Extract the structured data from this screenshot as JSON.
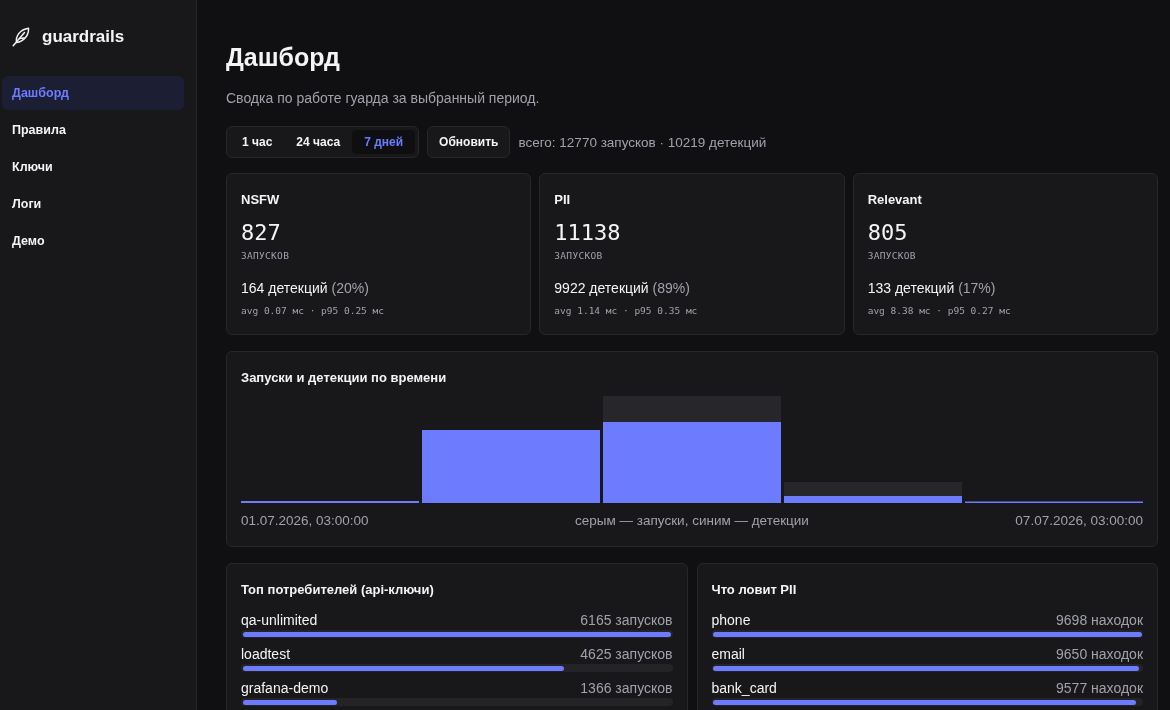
{
  "sidebar": {
    "logo": "guardrails",
    "items": [
      {
        "label": "Дашборд",
        "selected": true
      },
      {
        "label": "Правила",
        "selected": false
      },
      {
        "label": "Ключи",
        "selected": false
      },
      {
        "label": "Логи",
        "selected": false
      },
      {
        "label": "Демо",
        "selected": false
      }
    ]
  },
  "header": {
    "title": "Дашборд",
    "subtitle": "Сводка по работе гуарда за выбранный период."
  },
  "toolbar": {
    "periods": [
      {
        "label": "1 час",
        "selected": false
      },
      {
        "label": "24 часа",
        "selected": false
      },
      {
        "label": "7 дней",
        "selected": true
      }
    ],
    "refresh_button": "Обновить",
    "totals": "всего: 12770 запусков · 10219 детекций"
  },
  "guards": [
    {
      "name": "NSFW",
      "runs": "827",
      "runs_label": "ЗАПУСКОВ",
      "detections": "164 детекций",
      "share": "(20%)",
      "latency": "avg 0.07 мс · p95 0.25 мс"
    },
    {
      "name": "PII",
      "runs": "11138",
      "runs_label": "ЗАПУСКОВ",
      "detections": "9922 детекций",
      "share": "(89%)",
      "latency": "avg 1.14 мс · p95 0.35 мс"
    },
    {
      "name": "Relevant",
      "runs": "805",
      "runs_label": "ЗАПУСКОВ",
      "detections": "133 детекций",
      "share": "(17%)",
      "latency": "avg 8.38 мс · p95 0.27 мс"
    }
  ],
  "timeline": {
    "title": "Запуски и детекции по времени",
    "start_label": "01.07.2026, 03:00:00",
    "legend": "серым — запуски, синим — детекции",
    "end_label": "07.07.2026, 03:00:00"
  },
  "top_consumers": {
    "title": "Топ потребителей (api-ключи)",
    "rows": [
      {
        "name": "qa-unlimited",
        "count": "6165 запусков",
        "level": 1.0
      },
      {
        "name": "loadtest",
        "count": "4625 запусков",
        "level": 0.75
      },
      {
        "name": "grafana-demo",
        "count": "1366 запусков",
        "level": 0.22
      }
    ]
  },
  "pii_findings": {
    "title": "Что ловит PII",
    "rows": [
      {
        "name": "phone",
        "count": "9698 находок",
        "level": 1.0
      },
      {
        "name": "email",
        "count": "9650 находок",
        "level": 0.995
      },
      {
        "name": "bank_card",
        "count": "9577 находок",
        "level": 0.987
      }
    ]
  }
}
